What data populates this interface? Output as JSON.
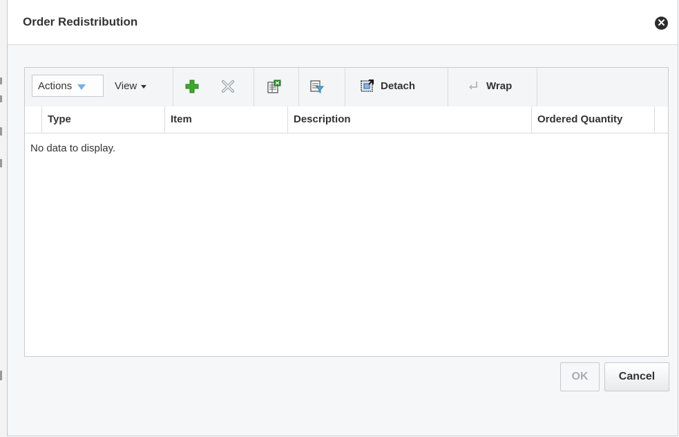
{
  "dialog": {
    "title": "Order Redistribution",
    "close_icon": "close-circle-icon"
  },
  "toolbar": {
    "actions_label": "Actions",
    "view_label": "View",
    "add_icon": "add-icon",
    "delete_icon": "delete-icon",
    "export_icon": "export-to-excel-icon",
    "filter_icon": "query-by-example-icon",
    "detach_label": "Detach",
    "detach_icon": "detach-icon",
    "wrap_label": "Wrap",
    "wrap_icon": "wrap-icon"
  },
  "table": {
    "columns": [
      "Type",
      "Item",
      "Description",
      "Ordered Quantity"
    ],
    "empty_text": "No data to display."
  },
  "buttons": {
    "ok_label": "OK",
    "cancel_label": "Cancel"
  },
  "colors": {
    "add_green": "#3fa72c",
    "disabled_grey": "#a7adb3",
    "dropdown_blue": "#7aaedc"
  }
}
